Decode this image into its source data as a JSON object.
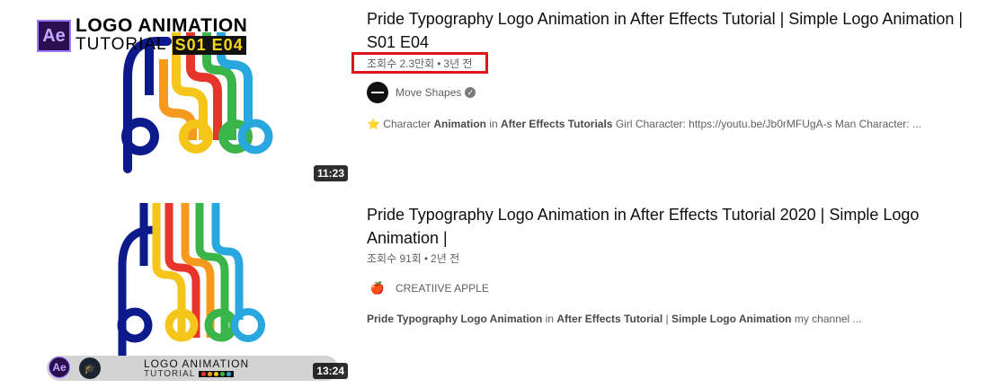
{
  "results": [
    {
      "title": "Pride Typography Logo Animation in After Effects Tutorial | Simple Logo Animation | S01 E04",
      "views": "조회수 2.3만회",
      "age": "3년 전",
      "channel": "Move Shapes",
      "verified": true,
      "duration": "11:23",
      "description": {
        "prefix": "⭐",
        "s1": "Character ",
        "b1": "Animation",
        "s2": " in ",
        "b2": "After Effects Tutorials",
        "s3": " Girl Character: https://youtu.be/Jb0rMFUgA-s Man Character: ..."
      },
      "thumb": {
        "ae_label": "Ae",
        "line1": "LOGO ANIMATION",
        "line2": "TUTORIAL",
        "tag": "S01 E04",
        "word": "pride"
      }
    },
    {
      "title": "Pride Typography Logo Animation in After Effects Tutorial 2020 | Simple Logo Animation |",
      "views": "조회수 91회",
      "age": "2년 전",
      "channel": "CREATIIVE APPLE",
      "verified": false,
      "duration": "13:24",
      "description": {
        "b1": "Pride Typography Logo Animation",
        "s1": " in ",
        "b2": "After Effects Tutorial",
        "s2": " | ",
        "b3": "Simple Logo Animation",
        "s3": " my channel ..."
      },
      "thumb": {
        "ae_label": "Ae",
        "line1": "LOGO   ANIMATION",
        "line2": "TUTORIAL",
        "word": "pride"
      }
    }
  ],
  "colors": {
    "highlight": "#e0141c",
    "navy": "#0d1a8c",
    "red": "#e8352b",
    "orange": "#f59a1d",
    "yellow": "#f6c51a",
    "green": "#3bb54a",
    "blue": "#29a8e0",
    "lightblue": "#4fc0f0"
  }
}
